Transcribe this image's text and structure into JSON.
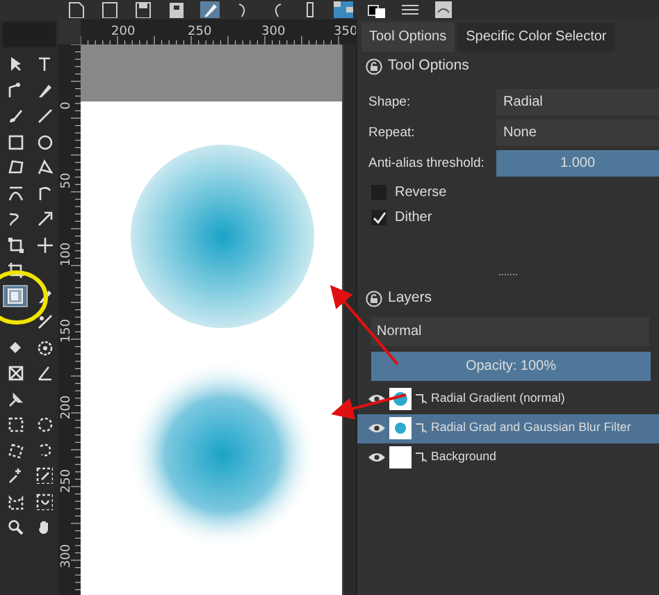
{
  "toolbox": {
    "tools": [
      {
        "kind": "pointer",
        "selected": false
      },
      {
        "kind": "text",
        "selected": false
      },
      {
        "kind": "node",
        "selected": false
      },
      {
        "kind": "pen",
        "selected": false
      },
      {
        "kind": "brush",
        "selected": false
      },
      {
        "kind": "line",
        "selected": false
      },
      {
        "kind": "rect",
        "selected": false
      },
      {
        "kind": "ellipse",
        "selected": false
      },
      {
        "kind": "polygon",
        "selected": false
      },
      {
        "kind": "polyline",
        "selected": false
      },
      {
        "kind": "bezier",
        "selected": false
      },
      {
        "kind": "freepath",
        "selected": false
      },
      {
        "kind": "curve",
        "selected": false
      },
      {
        "kind": "multibrush",
        "selected": false
      },
      {
        "kind": "transform",
        "selected": false
      },
      {
        "kind": "move",
        "selected": false
      },
      {
        "kind": "crop",
        "selected": false
      },
      {
        "kind": "none"
      },
      {
        "kind": "gradient",
        "selected": true
      },
      {
        "kind": "pen",
        "selected": false
      },
      {
        "kind": "none"
      },
      {
        "kind": "patch",
        "selected": false
      },
      {
        "kind": "fill",
        "selected": false
      },
      {
        "kind": "target",
        "selected": false
      },
      {
        "kind": "assistant",
        "selected": false
      },
      {
        "kind": "measure",
        "selected": false
      },
      {
        "kind": "pin",
        "selected": false
      },
      {
        "kind": "none"
      },
      {
        "kind": "rectsel",
        "selected": false
      },
      {
        "kind": "ellsel",
        "selected": false
      },
      {
        "kind": "polysel",
        "selected": false
      },
      {
        "kind": "freesel",
        "selected": false
      },
      {
        "kind": "wand",
        "selected": false
      },
      {
        "kind": "picksel",
        "selected": false
      },
      {
        "kind": "beziersel",
        "selected": false
      },
      {
        "kind": "magsel",
        "selected": false
      },
      {
        "kind": "zoom",
        "selected": false
      },
      {
        "kind": "hand",
        "selected": false
      }
    ]
  },
  "top_ruler": {
    "labels": [
      "200",
      "250",
      "300",
      "350"
    ]
  },
  "side_ruler": {
    "labels": [
      "0",
      "50",
      "100",
      "150",
      "200",
      "250",
      "300"
    ]
  },
  "dock": {
    "tabs": [
      {
        "label": "Tool Options",
        "selected": true
      },
      {
        "label": "Specific Color Selector",
        "selected": false
      }
    ],
    "tool_options": {
      "title": "Tool Options",
      "shape": {
        "label": "Shape:",
        "value": "Radial"
      },
      "repeat": {
        "label": "Repeat:",
        "value": "None"
      },
      "antialias": {
        "label": "Anti-alias threshold:",
        "value": "1.000",
        "level": 1
      },
      "checkboxes": [
        {
          "label": "Reverse",
          "checked": false
        },
        {
          "label": "Dither",
          "checked": true
        }
      ]
    },
    "layers": {
      "title": "Layers",
      "blend_mode": "Normal",
      "opacity": {
        "label": "Opacity:  100%",
        "level": 1
      },
      "items": [
        {
          "name": "Radial Gradient (normal)",
          "kind": "gradient",
          "visible": true,
          "selected": false
        },
        {
          "name": "Radial Grad and  Gaussian Blur Filter",
          "kind": "blurred",
          "visible": true,
          "selected": true
        },
        {
          "name": "Background",
          "kind": "plain",
          "visible": true,
          "selected": false
        }
      ]
    }
  }
}
